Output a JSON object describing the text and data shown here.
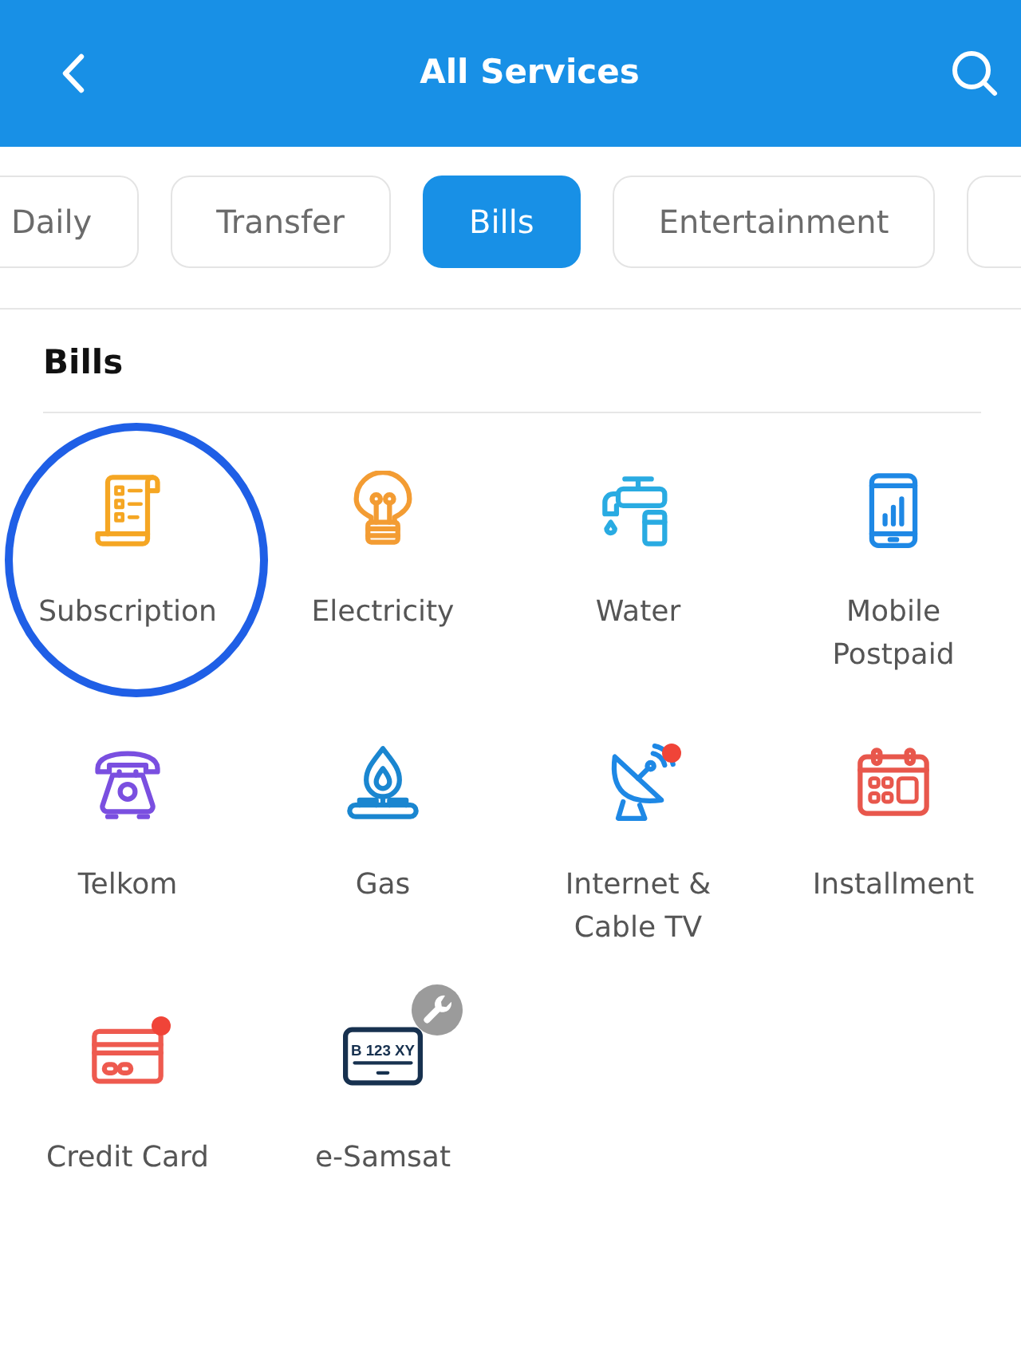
{
  "header": {
    "title": "All Services"
  },
  "tabs": [
    {
      "label": "Daily",
      "selected": false
    },
    {
      "label": "Transfer",
      "selected": false
    },
    {
      "label": "Bills",
      "selected": true
    },
    {
      "label": "Entertainment",
      "selected": false
    }
  ],
  "tabs_overflow_right": true,
  "section": {
    "title": "Bills",
    "items": [
      {
        "label": "Subscription",
        "highlighted": true,
        "notification_dot": false,
        "maintenance": false
      },
      {
        "label": "Electricity",
        "highlighted": false,
        "notification_dot": false,
        "maintenance": false
      },
      {
        "label": "Water",
        "highlighted": false,
        "notification_dot": false,
        "maintenance": false
      },
      {
        "label": "Mobile Postpaid",
        "highlighted": false,
        "notification_dot": false,
        "maintenance": false
      },
      {
        "label": "Telkom",
        "highlighted": false,
        "notification_dot": false,
        "maintenance": false
      },
      {
        "label": "Gas",
        "highlighted": false,
        "notification_dot": false,
        "maintenance": false
      },
      {
        "label": "Internet & Cable TV",
        "highlighted": false,
        "notification_dot": true,
        "maintenance": false
      },
      {
        "label": "Installment",
        "highlighted": false,
        "notification_dot": false,
        "maintenance": false
      },
      {
        "label": "Credit Card",
        "highlighted": false,
        "notification_dot": true,
        "maintenance": false
      },
      {
        "label": "e-Samsat",
        "highlighted": false,
        "notification_dot": false,
        "maintenance": true,
        "icon_text": "B 123 XY"
      }
    ]
  }
}
